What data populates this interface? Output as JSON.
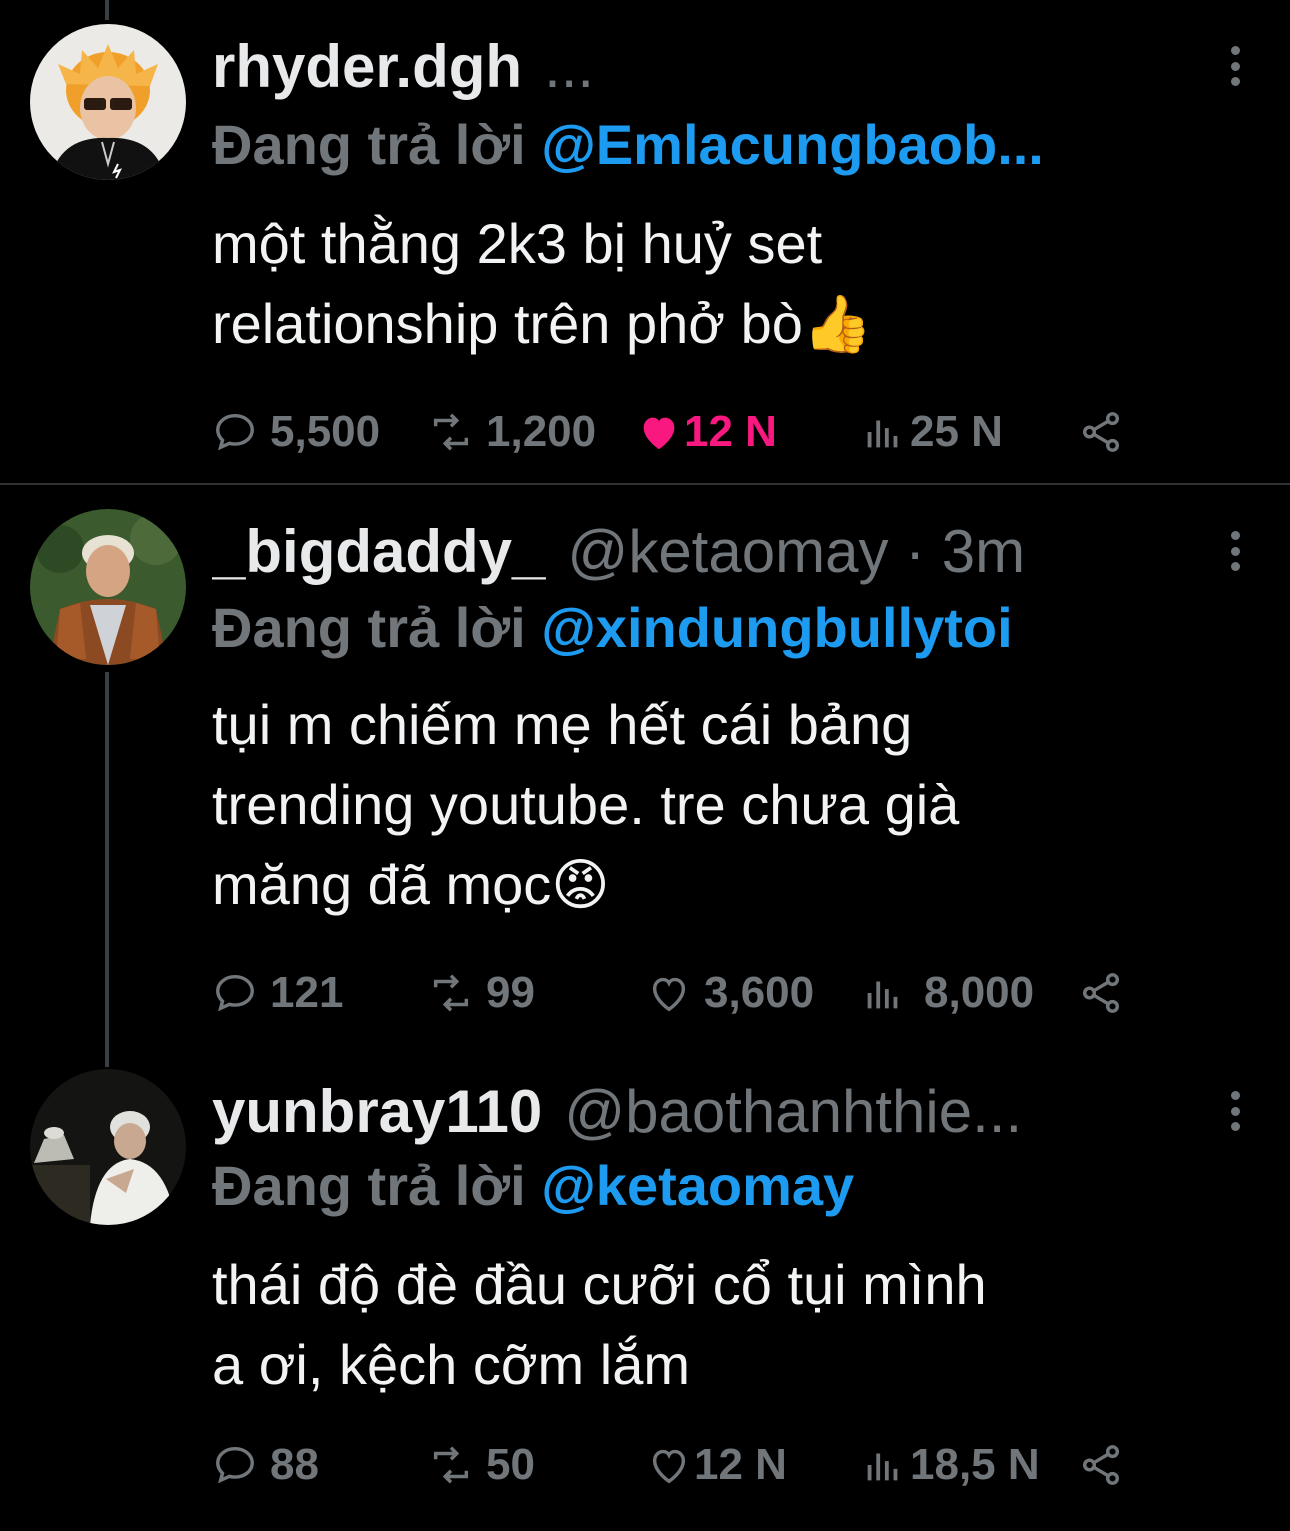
{
  "tweets": [
    {
      "name": "rhyder.dgh",
      "handle": "...",
      "reply_label": "Đang trả lời",
      "mention": "@Emlacungbaob...",
      "text_lines": [
        "một thằng 2k3 bị huỷ set",
        "relationship trên phở bò👍"
      ],
      "replies": "5,500",
      "retweets": "1,200",
      "likes": "12 N",
      "liked": true,
      "views": "25 N",
      "avatar_icon": "avatar-orange-hair"
    },
    {
      "name": "_bigdaddy_",
      "handle": "@ketaomay · 3m",
      "reply_label": "Đang trả lời",
      "mention": "@xindungbullytoi",
      "text_lines": [
        "tụi m chiếm mẹ hết cái bảng",
        "trending youtube. tre chưa già",
        "măng đã mọc😡"
      ],
      "replies": "121",
      "retweets": "99",
      "likes": "3,600",
      "liked": false,
      "views": "8,000",
      "avatar_icon": "avatar-leather-vest"
    },
    {
      "name": "yunbray110",
      "handle": "@baothanhthie...",
      "reply_label": "Đang trả lời",
      "mention": "@ketaomay",
      "text_lines": [
        "thái độ đè đầu cưỡi cổ tụi mình",
        "a ơi, kệch cỡm lắm"
      ],
      "replies": "88",
      "retweets": "50",
      "likes": "12 N",
      "liked": false,
      "views": "18,5 N",
      "avatar_icon": "avatar-white-shirt-dark"
    }
  ],
  "colors": {
    "background": "#000000",
    "name": "#e7e9ea",
    "muted": "#71767b",
    "mention": "#1d9bf0",
    "like_active": "#f91880"
  },
  "icons": [
    "reply-icon",
    "retweet-icon",
    "like-icon",
    "views-icon",
    "share-icon",
    "more-icon"
  ]
}
